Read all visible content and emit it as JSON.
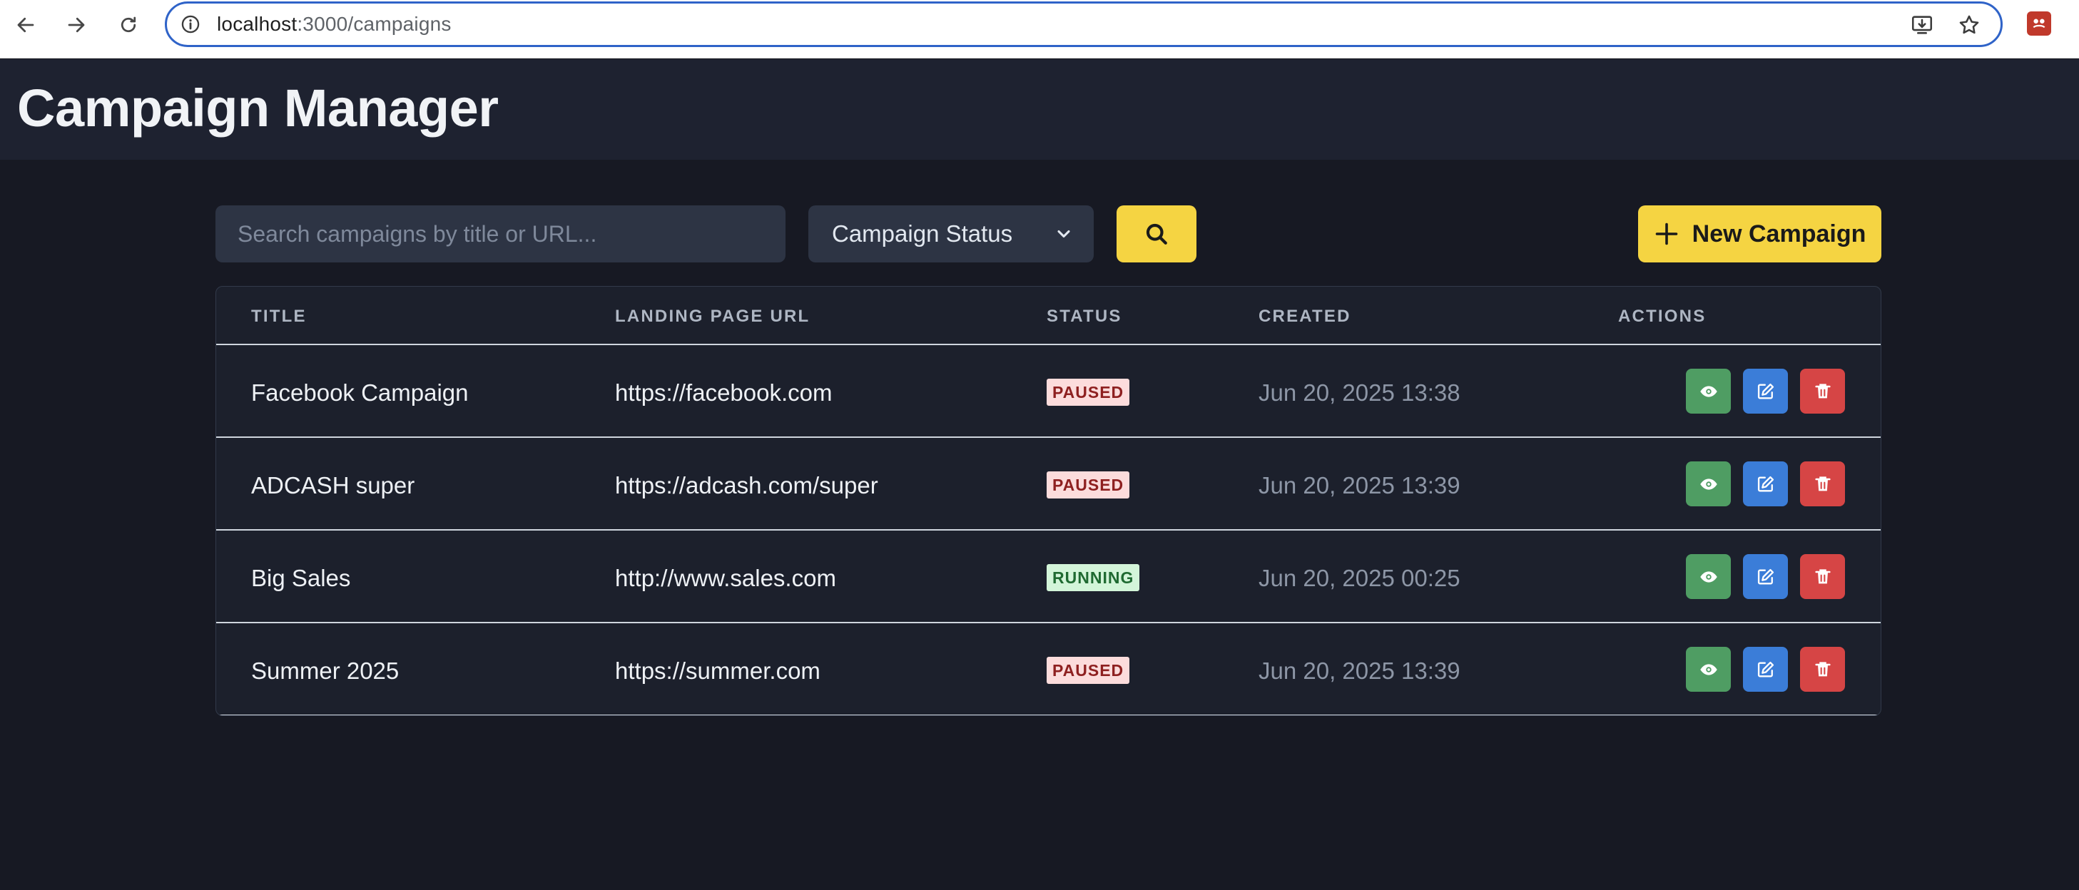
{
  "browser": {
    "url_host": "localhost",
    "url_rest": ":3000/campaigns"
  },
  "app": {
    "title": "Campaign Manager"
  },
  "toolbar": {
    "search_placeholder": "Search campaigns by title or URL...",
    "status_select_label": "Campaign Status",
    "new_button_label": "New Campaign"
  },
  "table": {
    "headers": {
      "title": "TITLE",
      "url": "LANDING PAGE URL",
      "status": "STATUS",
      "created": "CREATED",
      "actions": "ACTIONS"
    },
    "rows": [
      {
        "title": "Facebook Campaign",
        "url": "https://facebook.com",
        "status": "PAUSED",
        "created": "Jun 20, 2025 13:38"
      },
      {
        "title": "ADCASH super",
        "url": "https://adcash.com/super",
        "status": "PAUSED",
        "created": "Jun 20, 2025 13:39"
      },
      {
        "title": "Big Sales",
        "url": "http://www.sales.com",
        "status": "RUNNING",
        "created": "Jun 20, 2025 00:25"
      },
      {
        "title": "Summer 2025",
        "url": "https://summer.com",
        "status": "PAUSED",
        "created": "Jun 20, 2025 13:39"
      }
    ]
  },
  "colors": {
    "accent_yellow": "#f5d442",
    "view_green": "#4f9d63",
    "edit_blue": "#3b7dd8",
    "delete_red": "#d64545",
    "paused_bg": "#fcdcdc",
    "running_bg": "#d3f5d9"
  },
  "icons": {
    "view": "eye-icon",
    "edit": "edit-icon",
    "delete": "trash-icon",
    "search": "search-icon",
    "add": "plus-icon"
  }
}
